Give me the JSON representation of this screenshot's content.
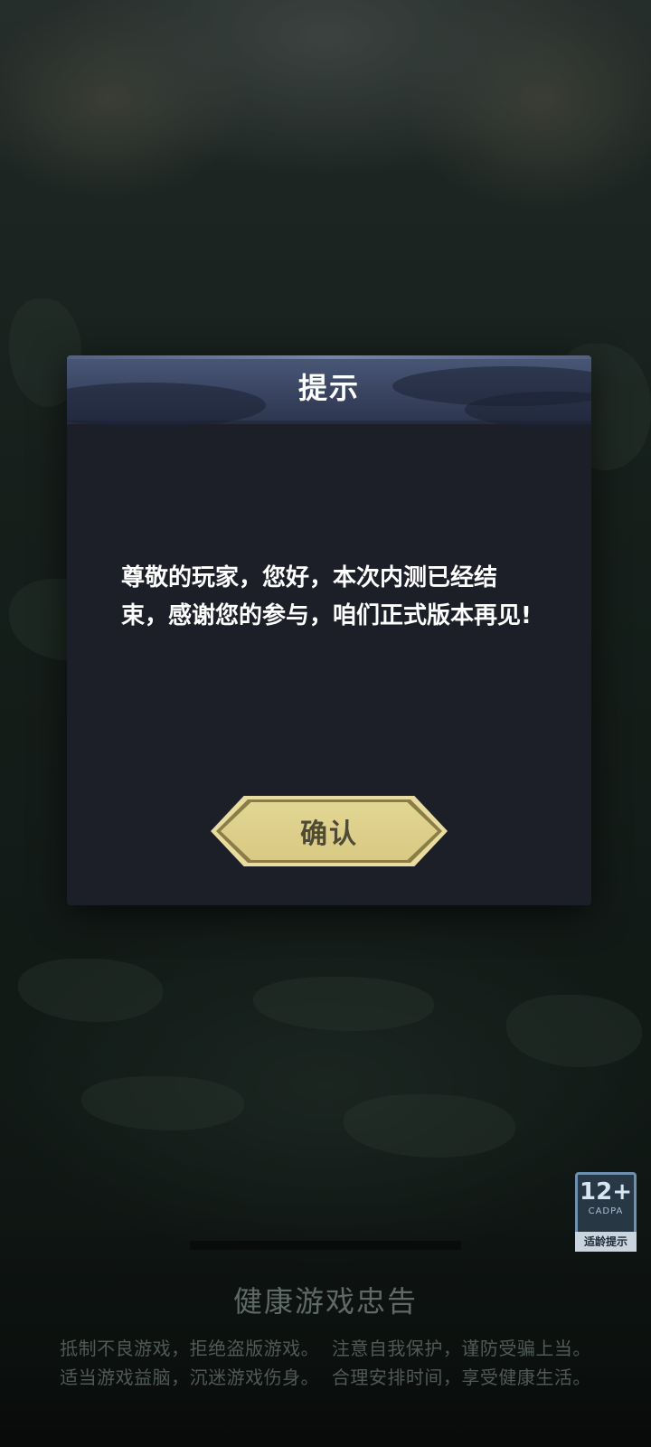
{
  "dialog": {
    "title": "提示",
    "message": "尊敬的玩家，您好，本次内测已经结束，感谢您的参与，咱们正式版本再见!",
    "confirm_label": "确认"
  },
  "age_badge": {
    "rating": "12+",
    "org": "CADPA",
    "label": "适龄提示"
  },
  "health_notice": {
    "title": "健康游戏忠告",
    "line1": "抵制不良游戏，拒绝盗版游戏。  注意自我保护，谨防受骗上当。",
    "line2": "适当游戏益脑，沉迷游戏伤身。  合理安排时间，享受健康生活。"
  },
  "colors": {
    "dialog_bg": "#1c1f28",
    "header_bg": "#3a4562",
    "button_gold": "#d8c983"
  }
}
